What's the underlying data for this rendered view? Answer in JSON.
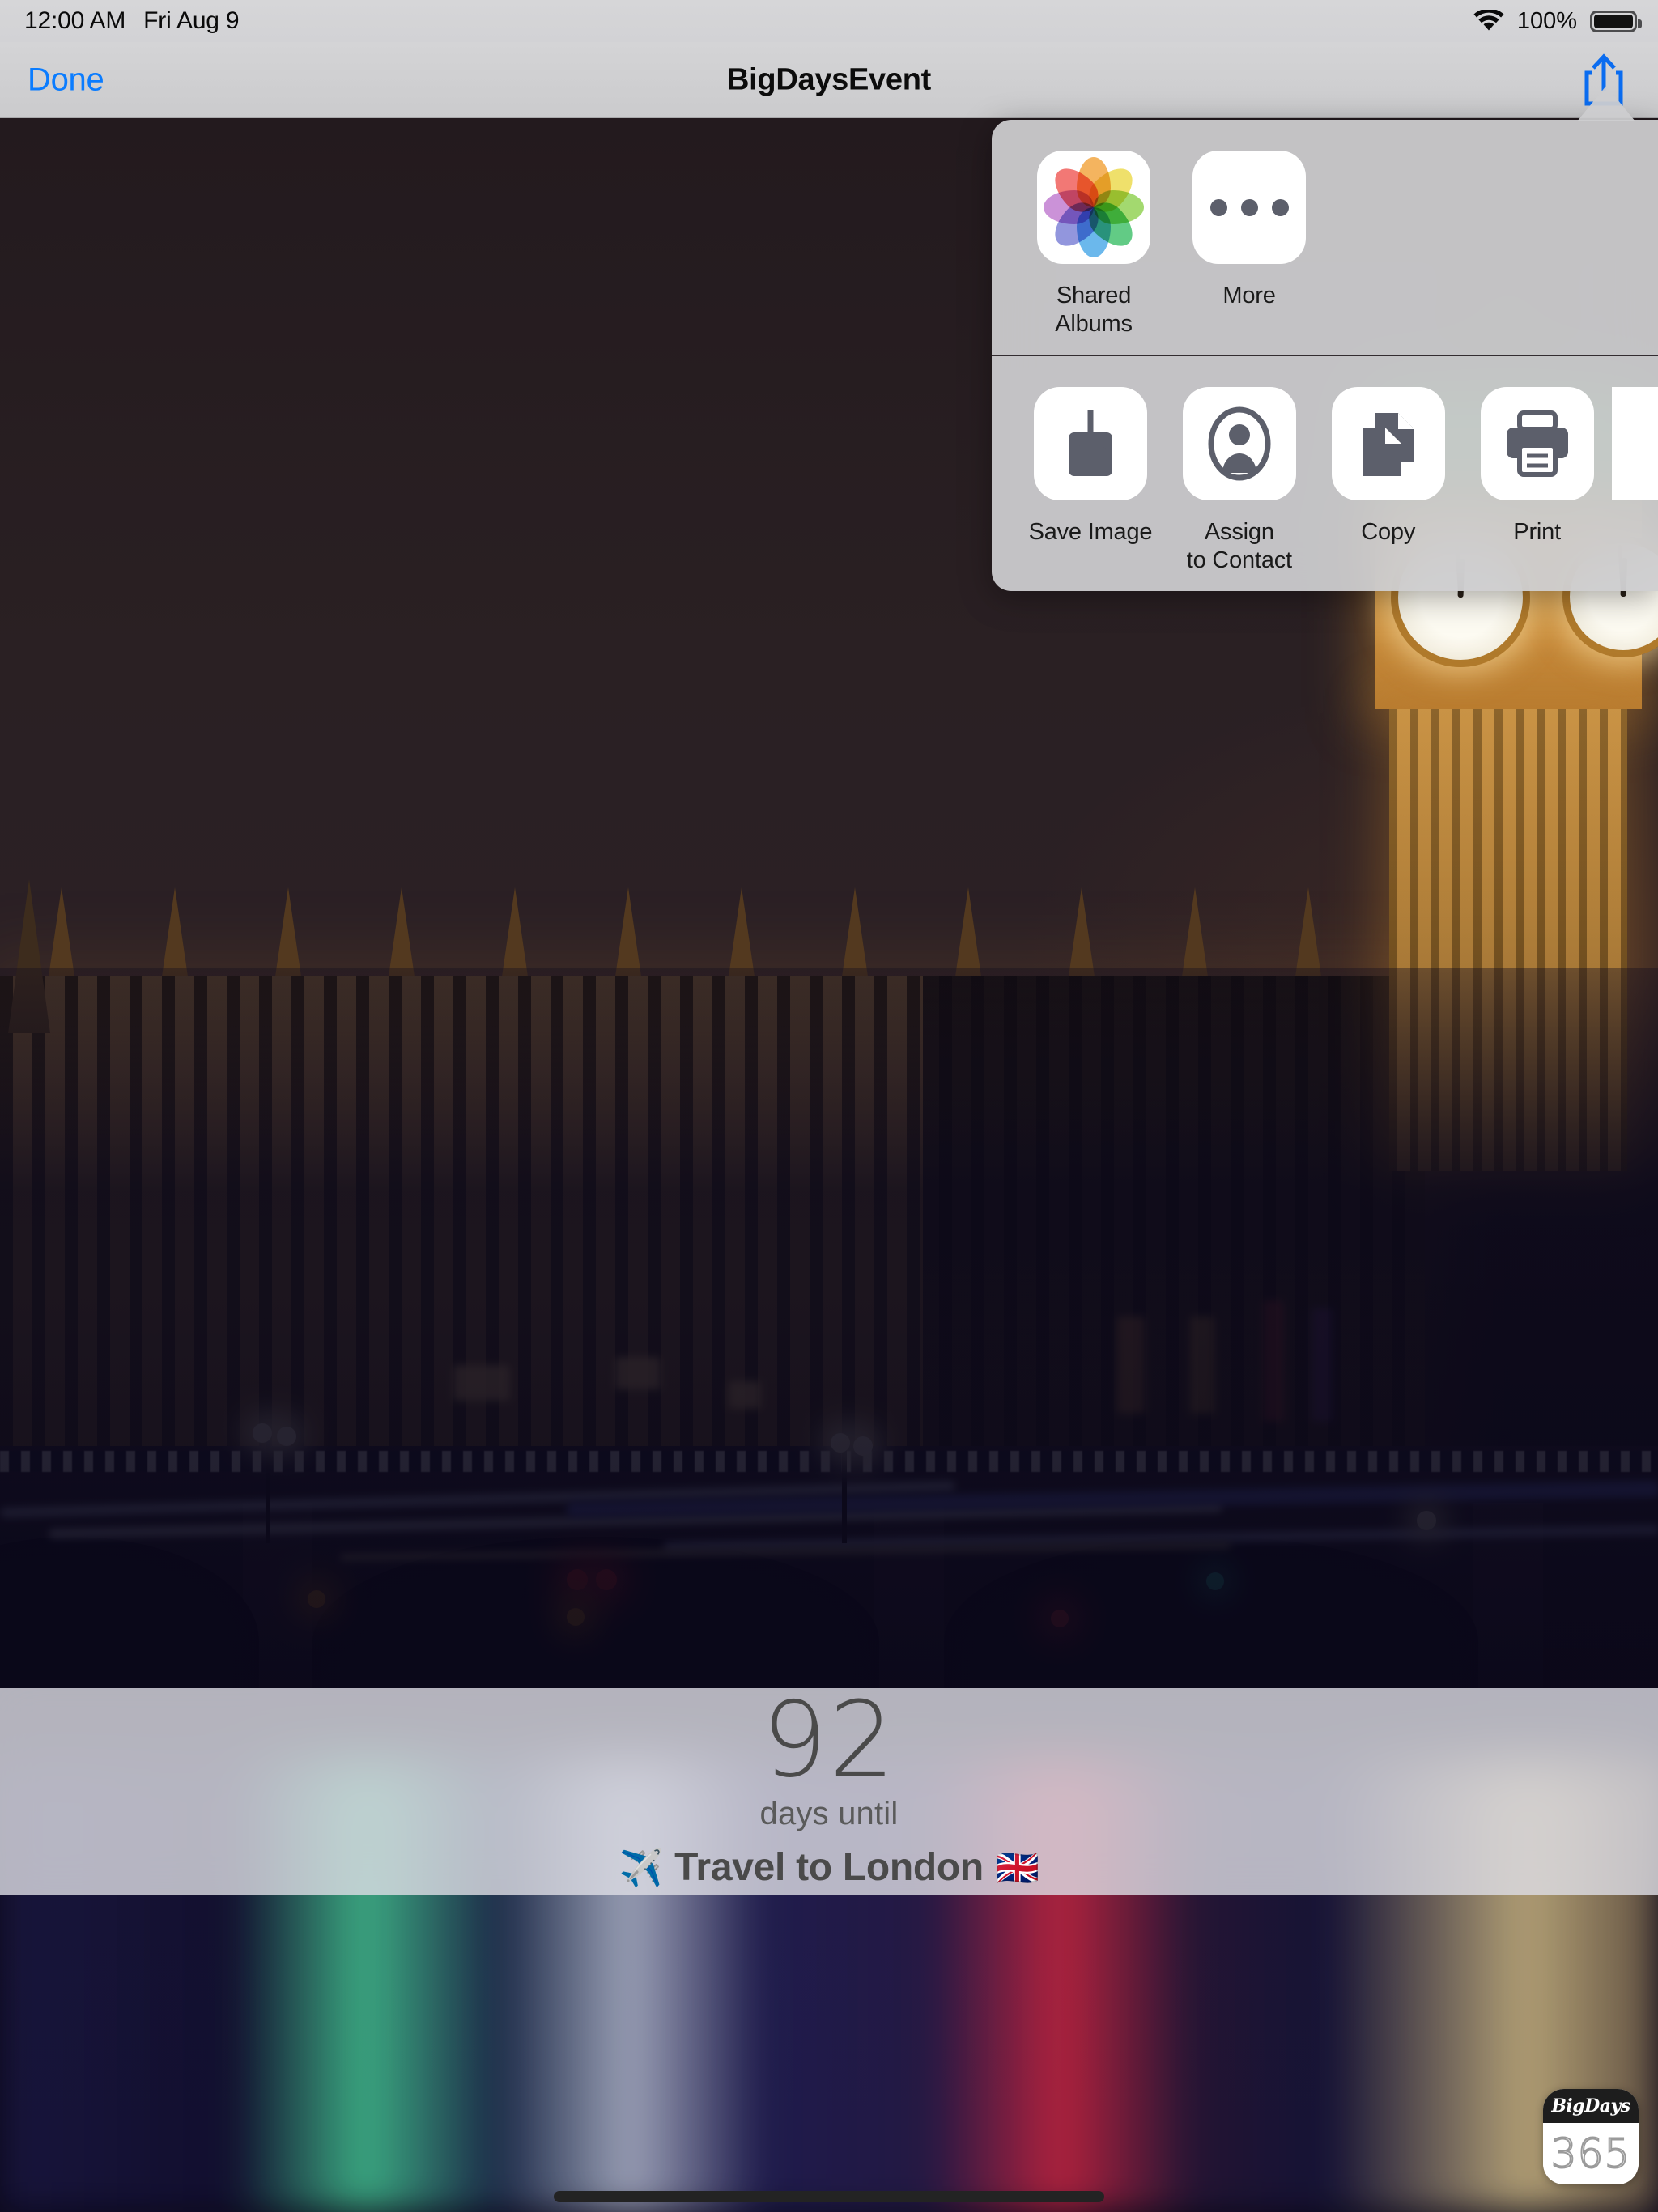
{
  "statusbar": {
    "time": "12:00 AM",
    "date": "Fri Aug 9",
    "battery_percent": "100%",
    "wifi_icon": "wifi-icon",
    "battery_icon": "battery-full-icon"
  },
  "navbar": {
    "done_label": "Done",
    "title": "BigDaysEvent",
    "share_icon": "share-up-arrow-icon",
    "done_color": "#0a7cff"
  },
  "share_sheet": {
    "apps_row": [
      {
        "label": "Shared Albums",
        "icon": "photos-pinwheel-icon"
      },
      {
        "label": "More",
        "icon": "ellipsis-icon"
      }
    ],
    "actions_row": [
      {
        "label": "Save Image",
        "icon": "save-download-icon"
      },
      {
        "label": "Assign\nto Contact",
        "label_line1": "Assign",
        "label_line2": "to Contact",
        "icon": "contact-person-icon"
      },
      {
        "label": "Copy",
        "icon": "copy-documents-icon"
      },
      {
        "label": "Print",
        "icon": "printer-icon"
      }
    ]
  },
  "countdown": {
    "number": "92",
    "subtitle": "days until",
    "event_emoji_left": "✈️",
    "event_title": "Travel to London",
    "event_emoji_right": "🇬🇧"
  },
  "watermark": {
    "brand": "BigDays",
    "number": "365"
  },
  "photo": {
    "description": "Night photo of Big Ben and the Palace of Westminster over Westminster Bridge with light trails reflected in the River Thames",
    "belfry_color": "#27a832",
    "stone_color": "#c28a3b",
    "sky_color": "#2a2023",
    "water_color": "#0a0718"
  },
  "home_indicator": "home-indicator"
}
